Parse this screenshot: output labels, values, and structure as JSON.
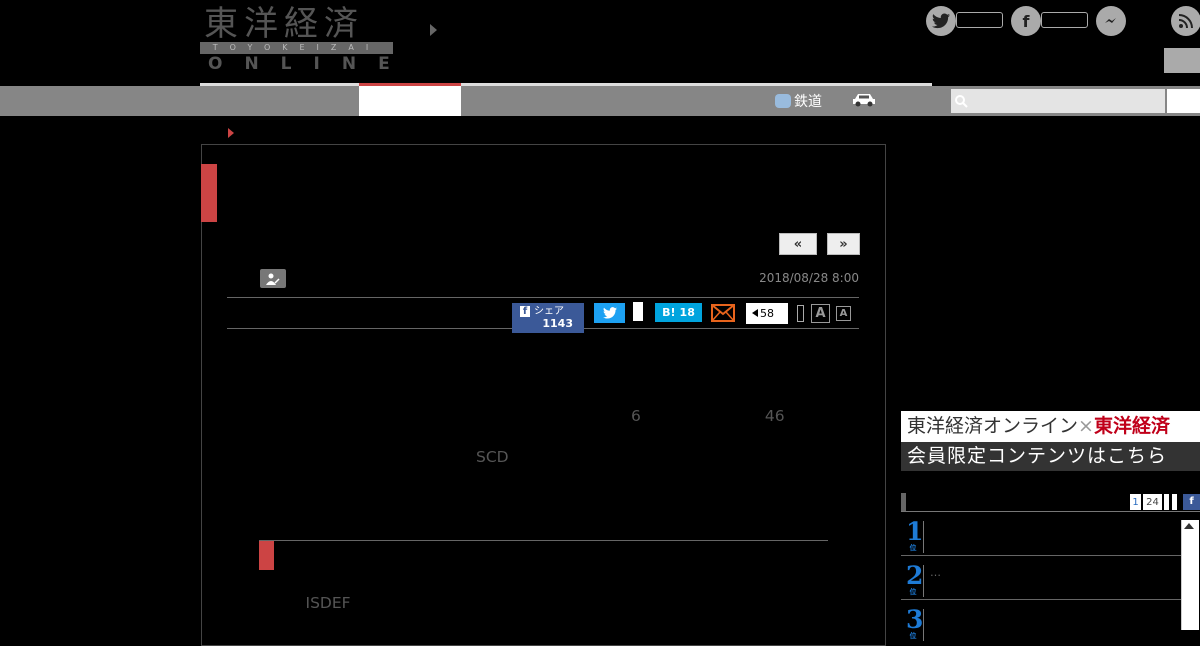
{
  "header": {
    "logo": {
      "kanji": "東洋経済",
      "romaji": "TOYOKEIZAI",
      "online": "ONLINE"
    },
    "social_icons": [
      "twitter-icon",
      "facebook-icon",
      "messenger-icon",
      "rss-icon"
    ]
  },
  "nav": {
    "railway_label": "鉄道",
    "car_icon": "car-icon",
    "search_icon": "search-icon"
  },
  "article": {
    "pager_prev": "«",
    "pager_next": "»",
    "date": "2018/08/28 8:00",
    "share": {
      "facebook_label": "シェア",
      "facebook_count": "1143",
      "hatena_label": "B!",
      "hatena_count": "18",
      "comment_count": "58",
      "font_large": "A",
      "font_small": "A"
    },
    "paragraphs": [
      {
        "lines": [
          "　　　　　　　　　　　　　　　　　　　　　　　　　　　　　　　　　　　　　　　　　　　　　",
          "　　　　　　　　　　　　　　　　　　　　　　　　　　　　　　　　　　　　　　　　　　　　　",
          "　　　　　　　　　　　　　　　　　　　　　　　　6　　　　　　　　46　　　　　　　　　　"
        ]
      },
      {
        "lines": [
          "　　　　　　　　　　　　　　SCD　　　　　　　　　　　　　　　　　　　　　　　　　　　　　",
          "　　　　　　　　　　　　　　　　　　　　　　　　　　　　　　　　　　　　　　　　　　　　　",
          "　　　"
        ]
      },
      {
        "lines": [
          "　　　ISDEF　　　　　　　　　　　　　　　　　　　　　　　　　　　　　　　　　　　　　　　",
          "　　　　　　　　　　　　　　　　　　　　　　　　　　　　　　　　　　　　　　　　　　　　"
        ]
      }
    ],
    "section_heading": "　　　　　　　　　　　　　　　　"
  },
  "sidebar": {
    "promo": {
      "line1_prefix": "東洋経済オンライン",
      "line1_x": "×",
      "line1_brand": "東洋経済",
      "line2": "会員限定コンテンツはこちら"
    },
    "ranking": {
      "tabs": [
        "1",
        "24"
      ],
      "facebook_label": "f",
      "items": [
        {
          "rank": "1",
          "unit": "位",
          "text": ""
        },
        {
          "rank": "2",
          "unit": "位",
          "text": "…"
        },
        {
          "rank": "3",
          "unit": "位",
          "text": ""
        }
      ]
    }
  }
}
